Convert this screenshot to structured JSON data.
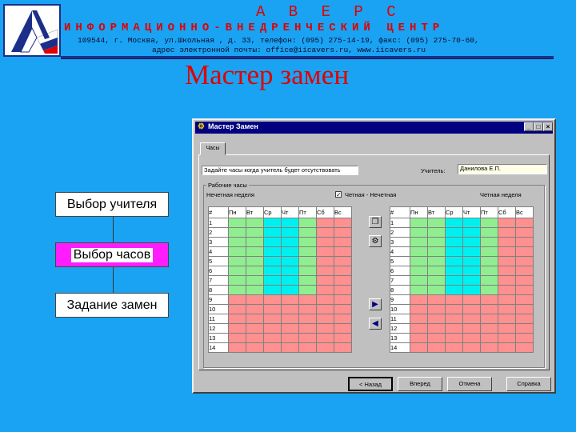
{
  "header": {
    "company": "А В Е Р С",
    "subtitle": "ИНФОРМАЦИОННО-ВНЕДРЕНЧЕСКИЙ ЦЕНТР",
    "address_line1": "109544, г. Москва, ул.Школьная , д. 33, телефон:  (095) 275-14-19, факс: (095) 275-70-60,",
    "address_line2": "адрес электронной почты: office@iicavers.ru, www.iicavers.ru"
  },
  "page_title": "Мастер замен",
  "flow": {
    "step1": "Выбор учителя",
    "step2": "Выбор часов",
    "step3": "Задание замен"
  },
  "window": {
    "title": "Мастер Замен",
    "tab": "Часы",
    "prompt": "Задайте часы когда учитель будет отсутствовать",
    "teacher_label": "Учитель:",
    "teacher_value": "Данилова Е.П.",
    "group_title": "Рабочие часы",
    "odd_week": "Нечетная неделя",
    "even_odd_check": "Четная - Нечетная",
    "even_week": "Четная неделя",
    "grid_headers": [
      "#",
      "Пн",
      "Вт",
      "Ср",
      "Чт",
      "Пт",
      "Сб",
      "Вс"
    ],
    "row_numbers": [
      "1",
      "2",
      "3",
      "4",
      "5",
      "6",
      "7",
      "8",
      "9",
      "10",
      "11",
      "12",
      "13",
      "14"
    ],
    "buttons": {
      "back": "< Назад",
      "next": "Вперед",
      "cancel": "Отмена",
      "help": "Справка"
    }
  },
  "colors": {
    "background": "#1aa3f2",
    "accent_red": "#e00000",
    "highlight_magenta": "#ff1dff",
    "cell_green": "#90ee90",
    "cell_cyan": "#00f0f0",
    "cell_pink": "#ff9090"
  },
  "icons": {
    "logo": "avers-logo",
    "side_btn_1": "copy-icon",
    "side_btn_2": "settings-icon",
    "side_btn_3": "arrow-right-icon",
    "side_btn_4": "arrow-left-icon"
  }
}
